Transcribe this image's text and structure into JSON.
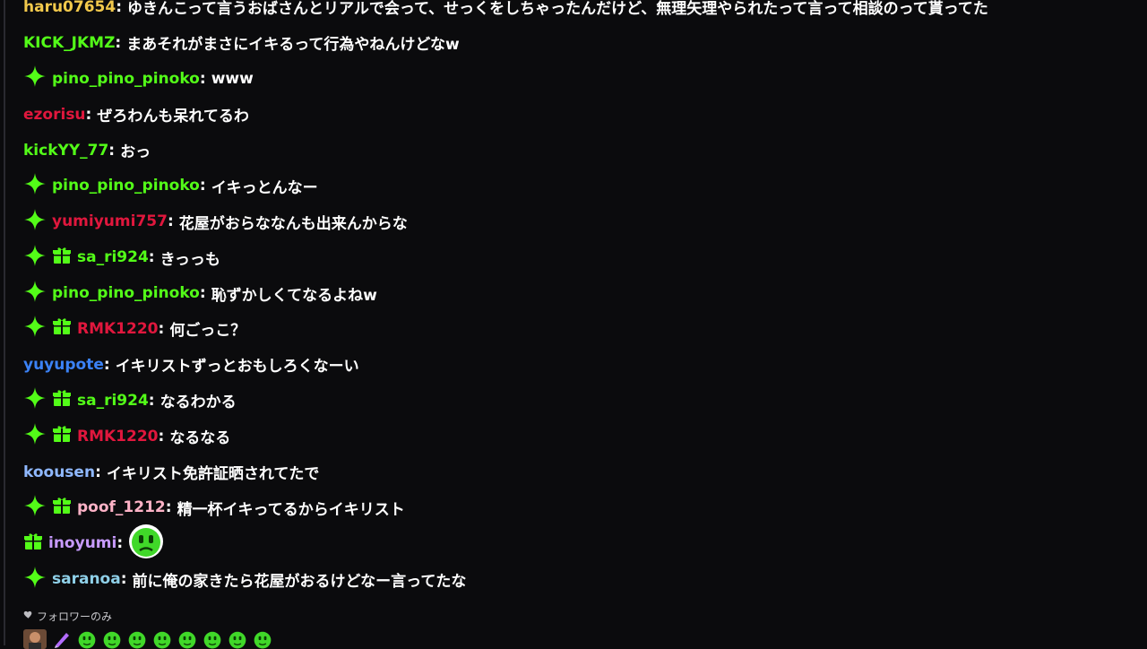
{
  "chat": {
    "messages": [
      {
        "user": "haru07654",
        "color": "#f2c94c",
        "badges": [],
        "text": "ゆきんこって言うおばさんとリアルで会って、せっくをしちゃったんだけど、無理矢理やられたって言って相談のって貰ってた"
      },
      {
        "user": "KICK_JKMZ",
        "color": "#53fc18",
        "badges": [],
        "text": "まあそれがまさにイキるって行為やねんけどなw"
      },
      {
        "user": "pino_pino_pinoko",
        "color": "#53fc18",
        "badges": [
          "sparkle"
        ],
        "text": "www"
      },
      {
        "user": "ezorisu",
        "color": "#e0173d",
        "badges": [],
        "text": "ぜろわんも呆れてるわ"
      },
      {
        "user": "kickYY_77",
        "color": "#53fc18",
        "badges": [],
        "text": "おっ"
      },
      {
        "user": "pino_pino_pinoko",
        "color": "#53fc18",
        "badges": [
          "sparkle"
        ],
        "text": "イキっとんなー"
      },
      {
        "user": "yumiyumi757",
        "color": "#e0173d",
        "badges": [
          "sparkle"
        ],
        "text": "花屋がおらななんも出来んからな"
      },
      {
        "user": "sa_ri924",
        "color": "#53fc18",
        "badges": [
          "sparkle",
          "gift"
        ],
        "text": "きっっも"
      },
      {
        "user": "pino_pino_pinoko",
        "color": "#53fc18",
        "badges": [
          "sparkle"
        ],
        "text": "恥ずかしくてなるよねw"
      },
      {
        "user": "RMK1220",
        "color": "#e0173d",
        "badges": [
          "sparkle",
          "gift"
        ],
        "text": "何ごっこ？"
      },
      {
        "user": "yuyupote",
        "color": "#3b82f6",
        "badges": [],
        "text": "イキリストずっとおもしろくなーい"
      },
      {
        "user": "sa_ri924",
        "color": "#53fc18",
        "badges": [
          "sparkle",
          "gift"
        ],
        "text": "なるわかる"
      },
      {
        "user": "RMK1220",
        "color": "#e0173d",
        "badges": [
          "sparkle",
          "gift"
        ],
        "text": "なるなる"
      },
      {
        "user": "koousen",
        "color": "#8fb8ff",
        "badges": [],
        "text": "イキリスト免許証晒されてたで"
      },
      {
        "user": "poof_1212",
        "color": "#ffb3c7",
        "badges": [
          "sparkle",
          "gift"
        ],
        "text": "精一杯イキってるからイキリスト"
      },
      {
        "user": "inoyumi",
        "color": "#c89bff",
        "badges": [
          "gift"
        ],
        "text": "",
        "emote": "green-face-emote"
      },
      {
        "user": "saranoa",
        "color": "#8fd0e8",
        "badges": [
          "sparkle"
        ],
        "text": "前に俺の家きたら花屋がおるけどなー言ってたな"
      }
    ]
  },
  "footer": {
    "followers_only_label": "フォロワーのみ",
    "followers_only_icon": "heart-icon",
    "emote_tray": [
      "avatar-emote",
      "pen-emote",
      "green-face-emote",
      "green-face-emote",
      "green-face-emote",
      "green-face-emote",
      "green-face-emote",
      "green-face-emote",
      "green-face-emote",
      "green-face-emote"
    ]
  },
  "colors": {
    "background": "#0b0b0d",
    "badge_green": "#53fc18",
    "text": "#ffffff"
  }
}
